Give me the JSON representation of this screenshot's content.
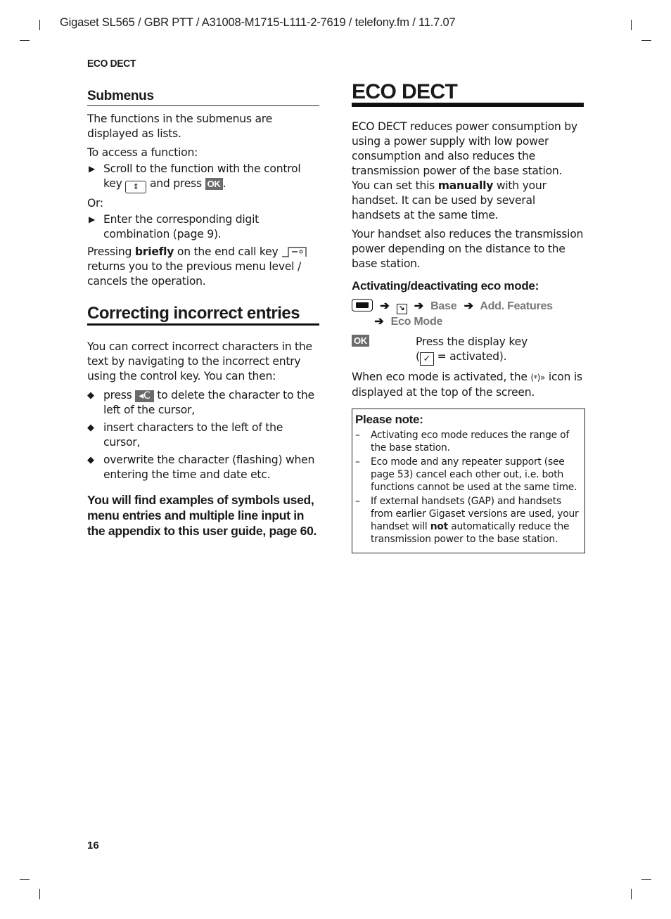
{
  "print_header": "Gigaset SL565 / GBR PTT / A31008-M1715-L111-2-7619 / telefony.fm / 11.7.07",
  "running_head": "ECO DECT",
  "page_number": "16",
  "left_column": {
    "submenus": {
      "heading": "Submenus",
      "intro": "The functions in the submenus are displayed as lists.",
      "access_label": "To access a function:",
      "step1_text_a": "Scroll to the function with the control key",
      "step1_text_b": "and press",
      "step1_text_c": ".",
      "or_label": "Or:",
      "step2_text": "Enter the corresponding digit combination (page 9).",
      "pressing_a": "Pressing",
      "pressing_bold": "briefly",
      "pressing_b": "on the end call key",
      "pressing_c": "returns you to the previous menu level / cancels the operation."
    },
    "correcting": {
      "heading": "Correcting incorrect entries",
      "intro": "You can correct incorrect characters in the text by navigating to the incorrect entry using the control key. You can then:",
      "item1_a": "press",
      "item1_b": "to delete the character to the left of the cursor,",
      "item2": "insert characters to the left of the cursor,",
      "item3": "overwrite the character (flashing) when entering the time and date etc.",
      "note": "You will find examples of symbols used, menu entries and multiple line input in the appendix to this user guide, page 60."
    }
  },
  "right_column": {
    "heading": "ECO DECT",
    "para1": "ECO DECT reduces power consumption by using a power supply with low power consumption and also reduces the transmission power of the base station.",
    "para2_a": "You can set this",
    "para2_bold": "manually",
    "para2_b": "with your handset. It can be used by several handsets at the same time.",
    "para3": "Your handset also reduces the transmission power depending on the distance to the base station.",
    "sub_heading": "Activating/deactivating eco mode:",
    "menu_path": [
      "Base",
      "Add. Features",
      "Eco Mode"
    ],
    "ok_label": "OK",
    "ok_desc_a": "Press the display key",
    "ok_desc_check": "✓",
    "ok_desc_b": "= activated).",
    "eco_icon_text_a": "When eco mode is activated, the",
    "eco_icon_glyph": "(ᵠ)»",
    "eco_icon_text_b": "icon is displayed at the top of the screen.",
    "please_note": {
      "title": "Please note:",
      "items": [
        "Activating eco mode reduces the range of the base station.",
        "Eco mode and any repeater support (see page 53) cancel each other out, i.e. both functions cannot be used at the same time."
      ],
      "item3_a": "If external handsets (GAP) and handsets from earlier Gigaset versions are used, your handset will",
      "item3_bold": "not",
      "item3_b": "automatically reduce the transmission power to the base station."
    }
  },
  "keys": {
    "ok_key_label": "OK",
    "c_key_label": "◂C",
    "control_key_glyph": "⇕",
    "bullet_glyph": "▶",
    "diamond_glyph": "◆",
    "arrow_glyph": "➔",
    "dash_glyph": "–"
  }
}
